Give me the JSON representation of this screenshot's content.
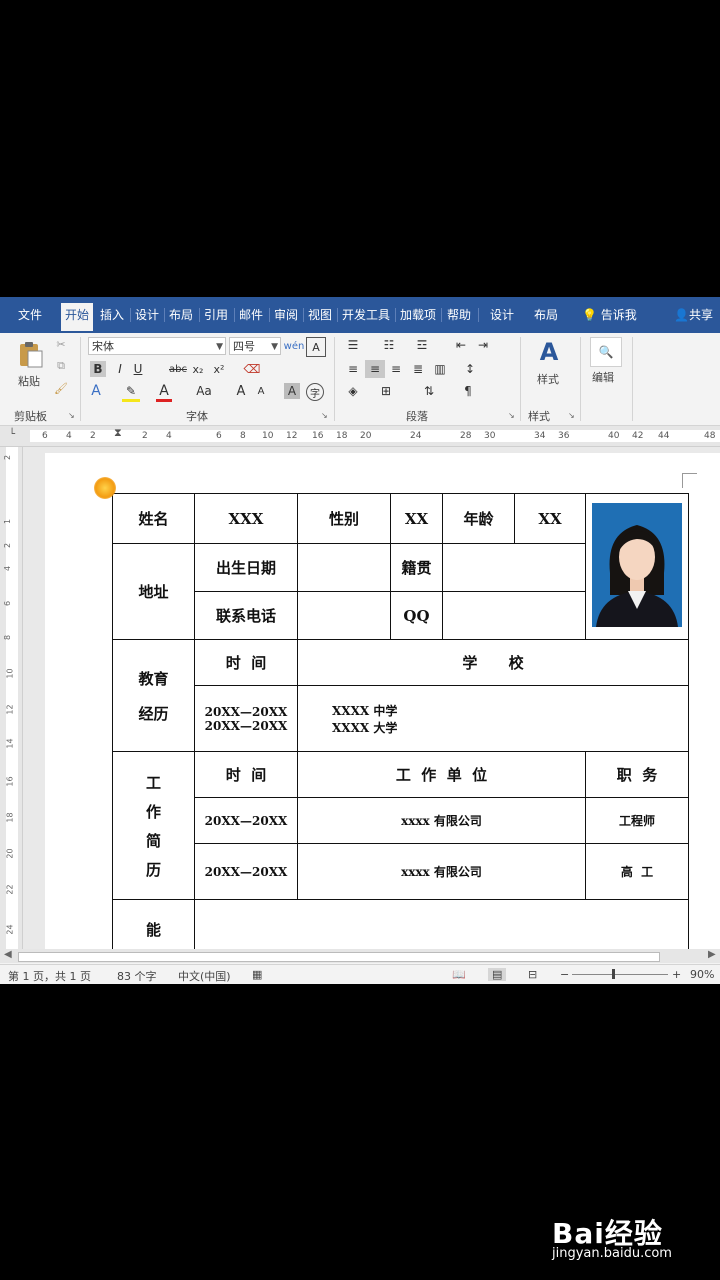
{
  "ribbon_tabs": [
    "文件",
    "开始",
    "插入",
    "设计",
    "布局",
    "引用",
    "邮件",
    "审阅",
    "视图",
    "开发工具",
    "加载项",
    "帮助",
    "设计",
    "布局"
  ],
  "active_tab_index": 1,
  "tell_me": "告诉我",
  "share": "共享",
  "clipboard": {
    "paste": "粘贴",
    "label": "剪贴板"
  },
  "font": {
    "name": "宋体",
    "size": "四号",
    "label": "字体"
  },
  "paragraph": {
    "label": "段落"
  },
  "styles": {
    "button": "样式",
    "label": "样式"
  },
  "editing": {
    "button": "编辑"
  },
  "ruler_ticks": [
    "6",
    "4",
    "2",
    "2",
    "4",
    "6",
    "8",
    "10",
    "12",
    "16",
    "18",
    "20",
    "24",
    "28",
    "30",
    "34",
    "36",
    "40",
    "42",
    "44",
    "48"
  ],
  "vruler_ticks": [
    "2",
    "1",
    "2",
    "4",
    "6",
    "8",
    "10",
    "12",
    "14",
    "16",
    "18",
    "20",
    "22",
    "24"
  ],
  "resume": {
    "name_label": "姓名",
    "name_value": "XXX",
    "gender_label": "性别",
    "gender_value": "XX",
    "age_label": "年龄",
    "age_value": "XX",
    "address_label": "地址",
    "birth_label": "出生日期",
    "native_label": "籍贯",
    "phone_label": "联系电话",
    "qq_label": "QQ",
    "edu_label_1": "教育",
    "edu_label_2": "经历",
    "time_label": "时  间",
    "school_label": "学      校",
    "edu_time_1": "20XX—20XX",
    "edu_time_2": "20XX—20XX",
    "edu_school_1": "XXXX 中学",
    "edu_school_2": "XXXX 大学",
    "work_chars": [
      "工",
      "作",
      "简",
      "历"
    ],
    "work_time_label": "时  间",
    "work_unit_label": "工  作  单  位",
    "work_role_label": "职  务",
    "work_rows": [
      {
        "time": "20XX—20XX",
        "unit": "xxxx 有限公司",
        "role": "工程师"
      },
      {
        "time": "20XX—20XX",
        "unit": "xxxx 有限公司",
        "role": "高  工"
      }
    ],
    "skill_label": "能"
  },
  "status_bar": {
    "page": "第 1 页，共 1 页",
    "words": "83 个字",
    "language": "中文(中国)",
    "zoom": "90%"
  },
  "watermark": {
    "logo": "Bai经验",
    "url": "jingyan.baidu.com"
  },
  "colors": {
    "ribbon_blue": "#2b579a",
    "document_bg": "#ffffff"
  }
}
